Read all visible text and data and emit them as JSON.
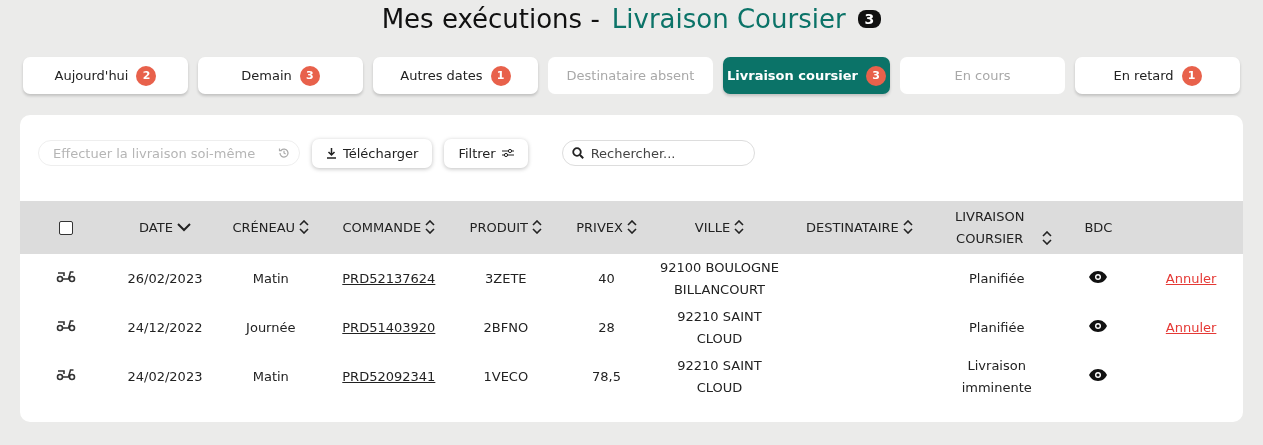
{
  "header": {
    "title": "Mes exécutions -",
    "highlight": "Livraison Coursier",
    "count": "3"
  },
  "tabs": [
    {
      "label": "Aujourd'hui",
      "count": "2",
      "selected": false,
      "disabled": false
    },
    {
      "label": "Demain",
      "count": "3",
      "selected": false,
      "disabled": false
    },
    {
      "label": "Autres dates",
      "count": "1",
      "selected": false,
      "disabled": false
    },
    {
      "label": "Destinataire absent",
      "selected": false,
      "disabled": true
    },
    {
      "label": "Livraison coursier",
      "count": "3",
      "selected": true,
      "disabled": false
    },
    {
      "label": "En cours",
      "selected": false,
      "disabled": true
    },
    {
      "label": "En retard",
      "count": "1",
      "selected": false,
      "disabled": false
    }
  ],
  "toolbar": {
    "self_delivery": {
      "placeholder": "Effectuer la livraison soi-même",
      "disabled": true
    },
    "download_button": "Télécharger",
    "filter_button": "Filtrer",
    "search": {
      "placeholder": "Rechercher..."
    }
  },
  "table": {
    "select_all": {
      "checked": false
    },
    "columns": [
      {
        "label": "DATE",
        "sortable": true,
        "sorted": true
      },
      {
        "label": "CRÉNEAU",
        "sortable": true,
        "sorted": false
      },
      {
        "label": "COMMANDE",
        "sortable": true,
        "sorted": false
      },
      {
        "label": "PRODUIT",
        "sortable": true,
        "sorted": false
      },
      {
        "label": "PRIVEX",
        "sortable": true,
        "sorted": false
      },
      {
        "label": "VILLE",
        "sortable": true,
        "sorted": false
      },
      {
        "label": "DESTINATAIRE",
        "sortable": true,
        "sorted": false
      },
      {
        "label": "LIVRAISON COURSIER",
        "sortable": true,
        "sorted": false
      },
      {
        "label": "BDC",
        "sortable": false
      }
    ],
    "rows": [
      {
        "date": "26/02/2023",
        "slot": "Matin",
        "order": "PRD52137624",
        "product": "3ZETE",
        "privex": "40",
        "city": "92100 BOULOGNE BILLANCOURT",
        "status": "Planifiée",
        "action": "Annuler"
      },
      {
        "date": "24/12/2022",
        "slot": "Journée",
        "order": "PRD51403920",
        "product": "2BFNO",
        "privex": "28",
        "city": "92210 SAINT CLOUD",
        "status": "Planifiée",
        "action": "Annuler"
      },
      {
        "date": "24/02/2023",
        "slot": "Matin",
        "order": "PRD52092341",
        "product": "1VECO",
        "privex": "78,5",
        "city": "92210 SAINT CLOUD",
        "status": "Livraison imminente"
      }
    ]
  }
}
